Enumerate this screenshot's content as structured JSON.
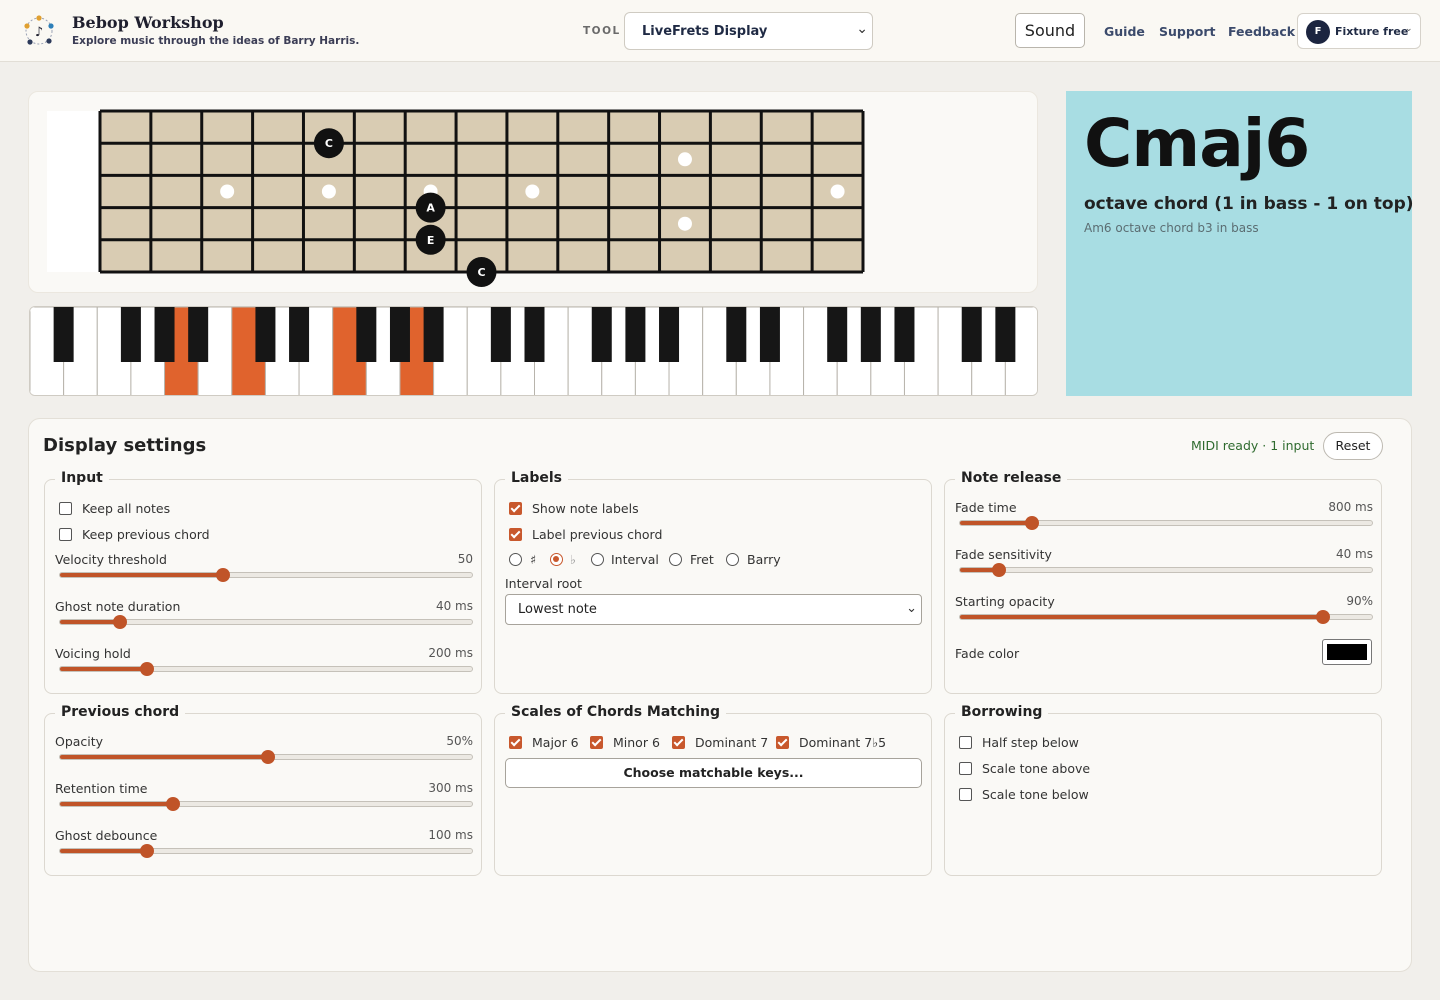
{
  "header": {
    "brand_title": "Bebop Workshop",
    "brand_subtitle": "Explore music through the ideas of Barry Harris.",
    "tool_label": "TOOL",
    "tool_selected": "LiveFrets Display",
    "sound_label": "Sound",
    "nav": [
      "Guide",
      "Support",
      "Feedback"
    ],
    "account_initial": "F",
    "account_label": "Fixture free",
    "account_caret": "⌄"
  },
  "fretboard": {
    "strings": 6,
    "frets": 15,
    "inlay_frets": [
      3,
      5,
      7,
      9,
      12,
      15
    ],
    "notes": [
      {
        "string": 2,
        "fret": 5,
        "label": "C"
      },
      {
        "string": 4,
        "fret": 7,
        "label": "A"
      },
      {
        "string": 5,
        "fret": 7,
        "label": "E"
      },
      {
        "string": 6,
        "fret": 8,
        "label": "C"
      }
    ]
  },
  "piano": {
    "white_keys": 30,
    "highlighted_white": [
      5,
      7,
      10,
      12
    ],
    "highlight_color": "#e0632d"
  },
  "chord": {
    "name": "Cmaj6",
    "description": "octave chord (1 in bass - 1 on top)",
    "alternate": "Am6 octave chord b3 in bass",
    "panel_color": "#a8dde3"
  },
  "settings": {
    "title": "Display settings",
    "midi_status": "MIDI ready · 1 input",
    "reset_label": "Reset",
    "input": {
      "legend": "Input",
      "checks": [
        {
          "label": "Keep all notes",
          "checked": false
        },
        {
          "label": "Keep previous chord",
          "checked": false
        }
      ],
      "sliders": [
        {
          "label": "Velocity threshold",
          "value": "50",
          "fraction": 0.395
        },
        {
          "label": "Ghost note duration",
          "value": "40 ms",
          "fraction": 0.145
        },
        {
          "label": "Voicing hold",
          "value": "200 ms",
          "fraction": 0.21
        }
      ]
    },
    "labels": {
      "legend": "Labels",
      "checks": [
        {
          "label": "Show note labels",
          "checked": true
        },
        {
          "label": "Label previous chord",
          "checked": true
        }
      ],
      "radios": [
        {
          "label": "♯",
          "selected": false
        },
        {
          "label": "♭",
          "selected": true
        },
        {
          "label": "Interval",
          "selected": false
        },
        {
          "label": "Fret",
          "selected": false
        },
        {
          "label": "Barry",
          "selected": false
        }
      ],
      "interval_root_label": "Interval root",
      "interval_root_value": "Lowest note"
    },
    "note_release": {
      "legend": "Note release",
      "sliders": [
        {
          "label": "Fade time",
          "value": "800 ms",
          "fraction": 0.175
        },
        {
          "label": "Fade sensitivity",
          "value": "40 ms",
          "fraction": 0.095
        },
        {
          "label": "Starting opacity",
          "value": "90%",
          "fraction": 0.88
        }
      ],
      "fade_color_label": "Fade color",
      "fade_color": "#000000"
    },
    "previous_chord": {
      "legend": "Previous chord",
      "sliders": [
        {
          "label": "Opacity",
          "value": "50%",
          "fraction": 0.505
        },
        {
          "label": "Retention time",
          "value": "300 ms",
          "fraction": 0.275
        },
        {
          "label": "Ghost debounce",
          "value": "100 ms",
          "fraction": 0.21
        }
      ]
    },
    "scales": {
      "legend": "Scales of Chords Matching",
      "checks": [
        {
          "label": "Major 6",
          "checked": true
        },
        {
          "label": "Minor 6",
          "checked": true
        },
        {
          "label": "Dominant 7",
          "checked": true
        },
        {
          "label": "Dominant 7♭5",
          "checked": true
        }
      ],
      "button_label": "Choose matchable keys..."
    },
    "borrowing": {
      "legend": "Borrowing",
      "checks": [
        {
          "label": "Half step below",
          "checked": false
        },
        {
          "label": "Scale tone above",
          "checked": false
        },
        {
          "label": "Scale tone below",
          "checked": false
        }
      ]
    }
  },
  "colors": {
    "accent": "#c05428",
    "fretboard_wood": "#d9ccb3",
    "fret_line": "#111111"
  }
}
